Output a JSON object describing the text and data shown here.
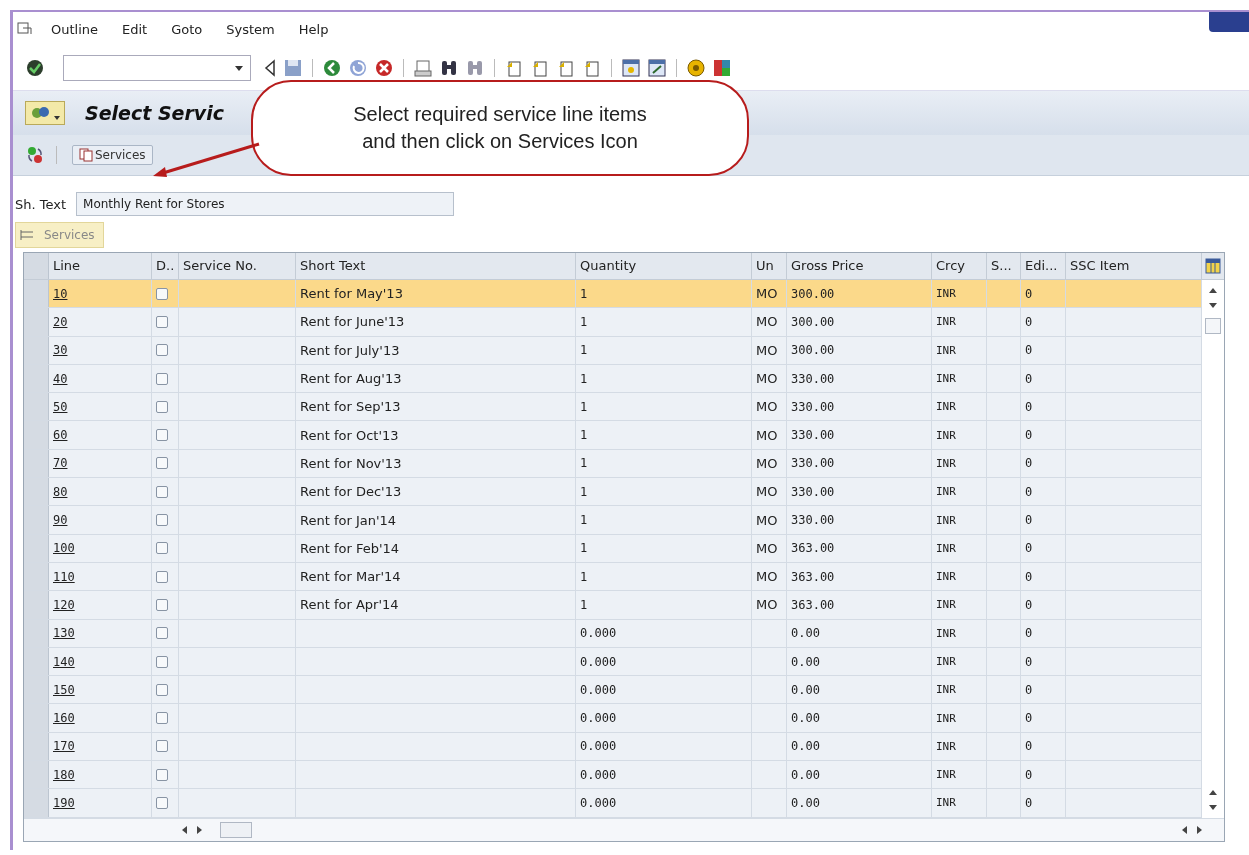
{
  "menu": [
    {
      "label": "Outline"
    },
    {
      "label": "Edit"
    },
    {
      "label": "Goto"
    },
    {
      "label": "System"
    },
    {
      "label": "Help"
    }
  ],
  "title": "Select Servic",
  "callout": {
    "text": "Select required service line items and then click on Services Icon"
  },
  "app_toolbar": {
    "services_button": "Services"
  },
  "short_text": {
    "label": "Sh. Text",
    "value": "Monthly Rent for Stores"
  },
  "tab": {
    "label": "Services"
  },
  "table": {
    "columns": [
      "Line",
      "D..",
      "Service No.",
      "Short Text",
      "Quantity",
      "Un",
      "Gross Price",
      "Crcy",
      "S...",
      "Edi...",
      "SSC Item"
    ],
    "rows": [
      {
        "line": "10",
        "checked": false,
        "short_text": "Rent for May'13",
        "quantity": "1",
        "unit": "MO",
        "gross_price": "300.00",
        "currency": "INR",
        "edition": "0",
        "selected": true
      },
      {
        "line": "20",
        "checked": false,
        "short_text": "Rent for June'13",
        "quantity": "1",
        "unit": "MO",
        "gross_price": "300.00",
        "currency": "INR",
        "edition": "0",
        "selected": false
      },
      {
        "line": "30",
        "checked": false,
        "short_text": "Rent for July'13",
        "quantity": "1",
        "unit": "MO",
        "gross_price": "300.00",
        "currency": "INR",
        "edition": "0",
        "selected": false
      },
      {
        "line": "40",
        "checked": false,
        "short_text": "Rent for Aug'13",
        "quantity": "1",
        "unit": "MO",
        "gross_price": "330.00",
        "currency": "INR",
        "edition": "0",
        "selected": false
      },
      {
        "line": "50",
        "checked": false,
        "short_text": "Rent for Sep'13",
        "quantity": "1",
        "unit": "MO",
        "gross_price": "330.00",
        "currency": "INR",
        "edition": "0",
        "selected": false
      },
      {
        "line": "60",
        "checked": false,
        "short_text": "Rent for Oct'13",
        "quantity": "1",
        "unit": "MO",
        "gross_price": "330.00",
        "currency": "INR",
        "edition": "0",
        "selected": false
      },
      {
        "line": "70",
        "checked": false,
        "short_text": "Rent for Nov'13",
        "quantity": "1",
        "unit": "MO",
        "gross_price": "330.00",
        "currency": "INR",
        "edition": "0",
        "selected": false
      },
      {
        "line": "80",
        "checked": false,
        "short_text": "Rent for Dec'13",
        "quantity": "1",
        "unit": "MO",
        "gross_price": "330.00",
        "currency": "INR",
        "edition": "0",
        "selected": false
      },
      {
        "line": "90",
        "checked": false,
        "short_text": "Rent for Jan'14",
        "quantity": "1",
        "unit": "MO",
        "gross_price": "330.00",
        "currency": "INR",
        "edition": "0",
        "selected": false
      },
      {
        "line": "100",
        "checked": false,
        "short_text": "Rent for Feb'14",
        "quantity": "1",
        "unit": "MO",
        "gross_price": "363.00",
        "currency": "INR",
        "edition": "0",
        "selected": false
      },
      {
        "line": "110",
        "checked": false,
        "short_text": "Rent for Mar'14",
        "quantity": "1",
        "unit": "MO",
        "gross_price": "363.00",
        "currency": "INR",
        "edition": "0",
        "selected": false
      },
      {
        "line": "120",
        "checked": false,
        "short_text": "Rent for Apr'14",
        "quantity": "1",
        "unit": "MO",
        "gross_price": "363.00",
        "currency": "INR",
        "edition": "0",
        "selected": false
      },
      {
        "line": "130",
        "checked": false,
        "quantity": "0.000",
        "gross_price": "0.00",
        "currency": "INR",
        "edition": "0",
        "selected": false
      },
      {
        "line": "140",
        "checked": false,
        "quantity": "0.000",
        "gross_price": "0.00",
        "currency": "INR",
        "edition": "0",
        "selected": false
      },
      {
        "line": "150",
        "checked": false,
        "quantity": "0.000",
        "gross_price": "0.00",
        "currency": "INR",
        "edition": "0",
        "selected": false
      },
      {
        "line": "160",
        "checked": false,
        "quantity": "0.000",
        "gross_price": "0.00",
        "currency": "INR",
        "edition": "0",
        "selected": false
      },
      {
        "line": "170",
        "checked": false,
        "quantity": "0.000",
        "gross_price": "0.00",
        "currency": "INR",
        "edition": "0",
        "selected": false
      },
      {
        "line": "180",
        "checked": false,
        "quantity": "0.000",
        "gross_price": "0.00",
        "currency": "INR",
        "edition": "0",
        "selected": false
      },
      {
        "line": "190",
        "checked": false,
        "quantity": "0.000",
        "gross_price": "0.00",
        "currency": "INR",
        "edition": "0",
        "selected": false
      }
    ]
  }
}
